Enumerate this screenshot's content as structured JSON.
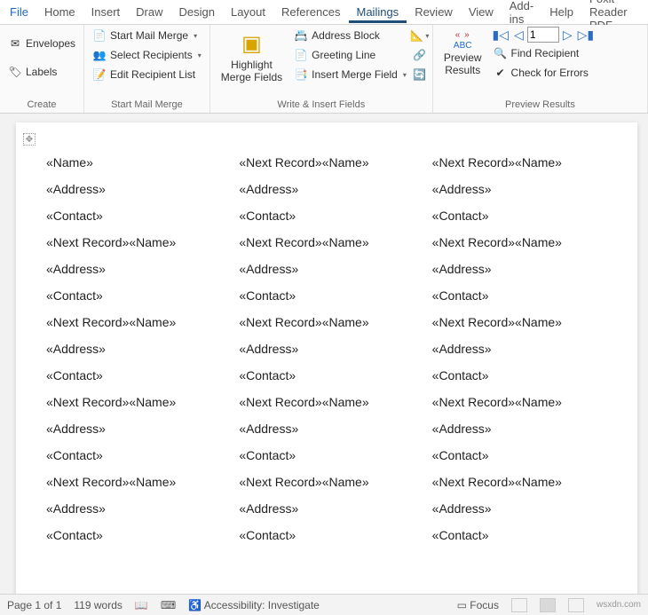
{
  "tabs": [
    "File",
    "Home",
    "Insert",
    "Draw",
    "Design",
    "Layout",
    "References",
    "Mailings",
    "Review",
    "View",
    "Add-ins",
    "Help",
    "Foxit Reader PDF"
  ],
  "active_tab": "Mailings",
  "ribbon": {
    "create": {
      "label": "Create",
      "envelopes": "Envelopes",
      "labels": "Labels"
    },
    "start": {
      "label": "Start Mail Merge",
      "start_merge": "Start Mail Merge",
      "select_recipients": "Select Recipients",
      "edit_list": "Edit Recipient List"
    },
    "write": {
      "label": "Write & Insert Fields",
      "highlight": "Highlight\nMerge Fields",
      "address_block": "Address Block",
      "greeting": "Greeting Line",
      "insert_field": "Insert Merge Field"
    },
    "preview": {
      "label": "Preview Results",
      "abc_arrows": "« »",
      "abc": "ABC",
      "preview": "Preview\nResults",
      "record": "1",
      "find": "Find Recipient",
      "errors": "Check for Errors"
    }
  },
  "labelgrid": {
    "name": "«Name»",
    "address": "«Address»",
    "contact": "«Contact»",
    "next": "«Next Record»«Name»",
    "rows": 5,
    "cols": 3
  },
  "status": {
    "page": "Page 1 of 1",
    "words": "119 words",
    "access": "Accessibility: Investigate",
    "focus": "Focus",
    "watermark": "wsxdn.com"
  }
}
